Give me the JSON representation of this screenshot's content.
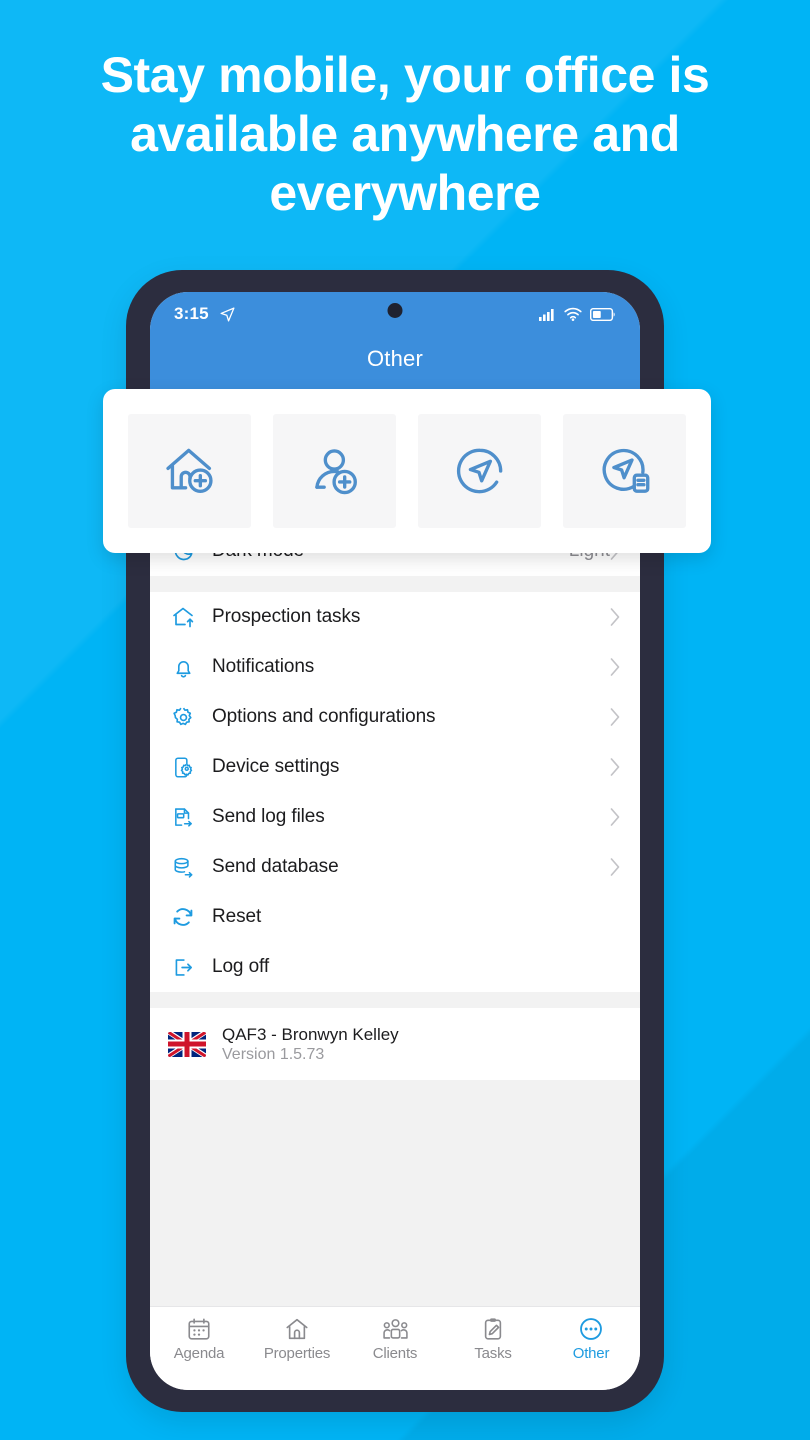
{
  "headline": "Stay mobile, your office is available anywhere and everywhere",
  "colors": {
    "background": "#00B4F5",
    "phone_bezel": "#2C2D3F",
    "app_header": "#3C8EDC",
    "accent": "#1E9BE0",
    "quick_icon": "#4F8FCB",
    "muted_text": "#8E8E93"
  },
  "phone": {
    "status_bar": {
      "time": "3:15",
      "location_icon": "location-arrow-icon",
      "signal_icon": "cellular-signal-icon",
      "wifi_icon": "wifi-icon",
      "battery_icon": "battery-icon",
      "battery_level_percent": 40
    },
    "header": {
      "title": "Other"
    }
  },
  "quick_actions": [
    {
      "name": "add-property",
      "icon": "house-plus-icon"
    },
    {
      "name": "add-client",
      "icon": "person-plus-icon"
    },
    {
      "name": "navigate",
      "icon": "navigation-arrow-circle-icon"
    },
    {
      "name": "navigate-with-report",
      "icon": "navigation-arrow-document-icon"
    }
  ],
  "menu": {
    "appearance": [
      {
        "label": "Dark mode",
        "value": "Light",
        "icon": "moon-icon",
        "chevron": true
      }
    ],
    "items": [
      {
        "label": "Prospection tasks",
        "icon": "house-arrow-up-icon",
        "chevron": true
      },
      {
        "label": "Notifications",
        "icon": "bell-icon",
        "chevron": true
      },
      {
        "label": "Options and configurations",
        "icon": "gear-icon",
        "chevron": true
      },
      {
        "label": "Device settings",
        "icon": "device-gear-icon",
        "chevron": true
      },
      {
        "label": "Send log files",
        "icon": "log-file-send-icon",
        "chevron": true
      },
      {
        "label": "Send database",
        "icon": "database-send-icon",
        "chevron": true
      },
      {
        "label": "Reset",
        "icon": "refresh-icon",
        "chevron": false
      },
      {
        "label": "Log off",
        "icon": "logout-icon",
        "chevron": false
      }
    ]
  },
  "account": {
    "flag_icon": "uk-flag-icon",
    "name": "QAF3 - Bronwyn Kelley",
    "version": "Version 1.5.73"
  },
  "tabs": [
    {
      "label": "Agenda",
      "icon": "calendar-icon",
      "active": false
    },
    {
      "label": "Properties",
      "icon": "house-icon",
      "active": false
    },
    {
      "label": "Clients",
      "icon": "people-icon",
      "active": false
    },
    {
      "label": "Tasks",
      "icon": "clipboard-pen-icon",
      "active": false
    },
    {
      "label": "Other",
      "icon": "ellipsis-circle-icon",
      "active": true
    }
  ]
}
